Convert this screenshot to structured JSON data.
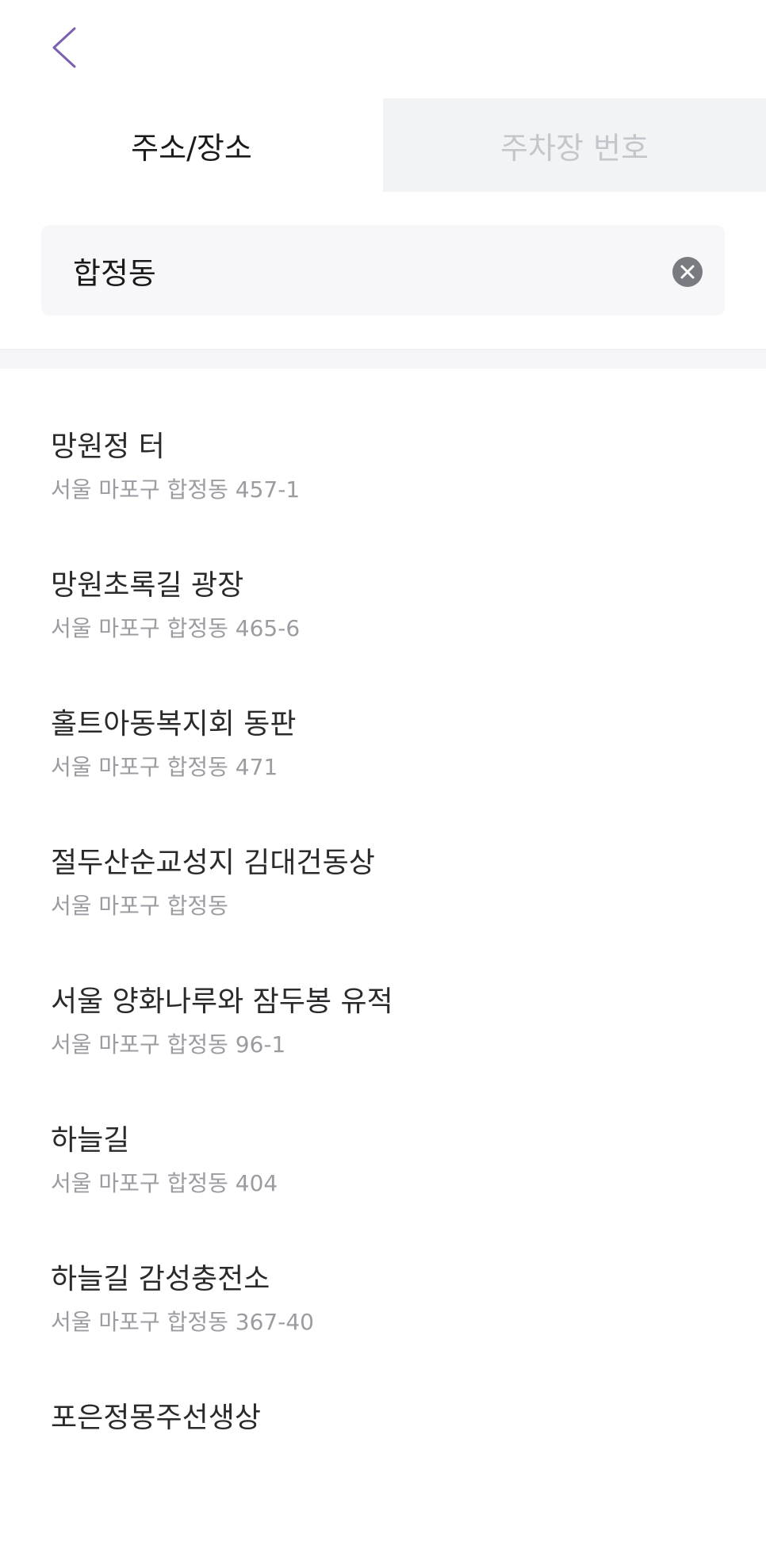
{
  "header": {
    "back_icon": "chevron-left-icon",
    "accent_color": "#7b5fb0"
  },
  "tabs": [
    {
      "label": "주소/장소",
      "active": true
    },
    {
      "label": "주차장 번호",
      "active": false
    }
  ],
  "search": {
    "value": "합정동",
    "clear_icon": "clear-circle-icon"
  },
  "results": [
    {
      "name": "망원정 터",
      "address": "서울 마포구 합정동 457-1"
    },
    {
      "name": "망원초록길 광장",
      "address": "서울 마포구 합정동 465-6"
    },
    {
      "name": "홀트아동복지회 동판",
      "address": "서울 마포구 합정동 471"
    },
    {
      "name": "절두산순교성지 김대건동상",
      "address": "서울 마포구 합정동"
    },
    {
      "name": "서울 양화나루와 잠두봉 유적",
      "address": "서울 마포구 합정동 96-1"
    },
    {
      "name": "하늘길",
      "address": "서울 마포구 합정동 404"
    },
    {
      "name": "하늘길 감성충전소",
      "address": "서울 마포구 합정동 367-40"
    },
    {
      "name": "포은정몽주선생상",
      "address": ""
    }
  ]
}
